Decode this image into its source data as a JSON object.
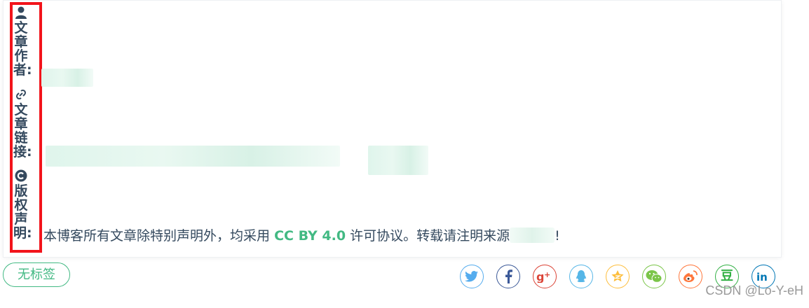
{
  "labels": {
    "author": "文章作者:",
    "link": "文章链接:",
    "copyright": "版权声明:"
  },
  "copyright": {
    "before": "本博客所有文章除特别声明外，均采用",
    "license": "CC BY 4.0",
    "after": "许可协议。转载请注明来源",
    "end": "!"
  },
  "tag": "无标签",
  "share": [
    {
      "name": "twitter-icon",
      "color": "#55acee"
    },
    {
      "name": "facebook-icon",
      "color": "#3b5998"
    },
    {
      "name": "google-plus-icon",
      "color": "#db4437"
    },
    {
      "name": "qq-icon",
      "color": "#56b6e7"
    },
    {
      "name": "qzone-icon",
      "color": "#fdbe3d"
    },
    {
      "name": "wechat-icon",
      "color": "#7bc549"
    },
    {
      "name": "weibo-icon",
      "color": "#ff763b"
    },
    {
      "name": "douban-icon",
      "color": "#33b045"
    },
    {
      "name": "linkedin-icon",
      "color": "#0077b5"
    }
  ],
  "watermark": "CSDN @Lo-Y-eH"
}
